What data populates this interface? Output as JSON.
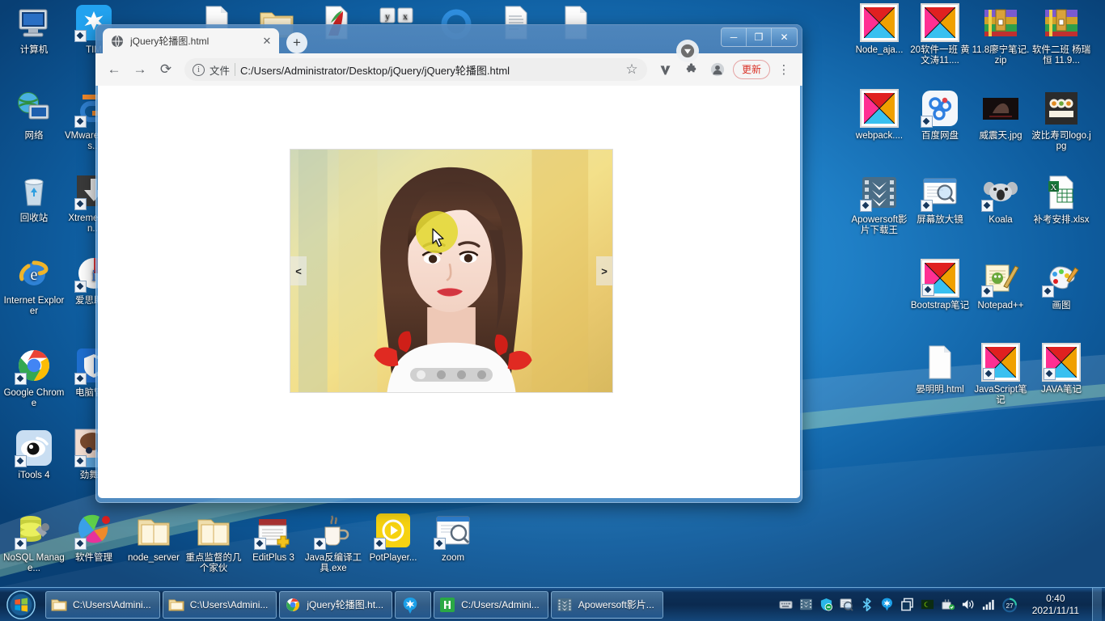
{
  "desktop": {
    "icons_col1": [
      {
        "label": "计算机",
        "icon": "computer-icon",
        "shortcut": false
      },
      {
        "label": "网络",
        "icon": "network-icon",
        "shortcut": false
      },
      {
        "label": "回收站",
        "icon": "recycle-bin-icon",
        "shortcut": false
      },
      {
        "label": "Internet Explorer",
        "icon": "internet-explorer-icon",
        "shortcut": false
      },
      {
        "label": "Google Chrome",
        "icon": "google-chrome-icon",
        "shortcut": true
      },
      {
        "label": "iTools 4",
        "icon": "itools-icon",
        "shortcut": true
      },
      {
        "label": "NoSQL Manage...",
        "icon": "nosql-manager-icon",
        "shortcut": true
      }
    ],
    "icons_col2": [
      {
        "label": "TIM",
        "icon": "tim-icon",
        "shortcut": true
      },
      {
        "label": "VMware Works...",
        "icon": "vmware-workstation-icon",
        "shortcut": true
      },
      {
        "label": "Xtreme Down...",
        "icon": "xtreme-download-icon",
        "shortcut": true
      },
      {
        "label": "爱思助手",
        "icon": "aisi-assistant-icon",
        "shortcut": true
      },
      {
        "label": "电脑管家",
        "icon": "pc-manager-icon",
        "shortcut": true
      },
      {
        "label": "劲舞团",
        "icon": "audition-game-icon",
        "shortcut": true
      },
      {
        "label": "软件管理",
        "icon": "software-manager-icon",
        "shortcut": true
      }
    ],
    "icons_bottom_row": [
      {
        "label": "node_server",
        "icon": "folder-icon",
        "shortcut": false
      },
      {
        "label": "重点监督的几个家伙",
        "icon": "folder-icon",
        "shortcut": false
      },
      {
        "label": "EditPlus 3",
        "icon": "editplus-icon",
        "shortcut": true
      },
      {
        "label": "Java反编译工具.exe",
        "icon": "java-decompiler-icon",
        "shortcut": true
      },
      {
        "label": "PotPlayer...",
        "icon": "potplayer-icon",
        "shortcut": true
      },
      {
        "label": "zoom",
        "icon": "zoom-icon",
        "shortcut": true
      }
    ],
    "icons_right": [
      {
        "label": "Node_aja...",
        "icon": "broken-image-icon",
        "shortcut": false
      },
      {
        "label": "20软件一班 黄文涛11....",
        "icon": "broken-image-icon",
        "shortcut": false
      },
      {
        "label": "11.8廖宁笔记.zip",
        "icon": "winrar-archive-icon",
        "shortcut": false
      },
      {
        "label": "软件二班 杨瑞恒 11.9...",
        "icon": "winrar-archive-icon",
        "shortcut": false
      },
      {
        "label": "webpack....",
        "icon": "broken-image-icon",
        "shortcut": false
      },
      {
        "label": "百度网盘",
        "icon": "baidu-netdisk-icon",
        "shortcut": true
      },
      {
        "label": "威震天.jpg",
        "icon": "jpg-thumbnail-icon",
        "shortcut": false
      },
      {
        "label": "波比寿司logo.jpg",
        "icon": "jpg-thumbnail-icon",
        "shortcut": false
      },
      {
        "label": "Apowersoft影片下载王",
        "icon": "apowersoft-icon",
        "shortcut": true
      },
      {
        "label": "屏幕放大镜",
        "icon": "screen-magnifier-icon",
        "shortcut": true
      },
      {
        "label": "Koala",
        "icon": "koala-icon",
        "shortcut": true
      },
      {
        "label": "补考安排.xlsx",
        "icon": "excel-file-icon",
        "shortcut": false
      },
      {
        "label": "Bootstrap笔记",
        "icon": "broken-image-icon",
        "shortcut": true
      },
      {
        "label": "Notepad++",
        "icon": "notepadpp-icon",
        "shortcut": true
      },
      {
        "label": "画图",
        "icon": "paint-icon",
        "shortcut": true
      },
      {
        "label": "晏明明.html",
        "icon": "blank-file-icon",
        "shortcut": false
      },
      {
        "label": "JavaScript笔记",
        "icon": "broken-image-icon",
        "shortcut": true
      },
      {
        "label": "JAVA笔记",
        "icon": "broken-image-icon",
        "shortcut": true
      }
    ]
  },
  "browser": {
    "tab": {
      "title": "jQuery轮播图.html",
      "close_label": "✕",
      "favicon": "globe-icon"
    },
    "new_tab_label": "+",
    "window_controls": {
      "minimize": "─",
      "maximize": "❐",
      "close": "✕"
    },
    "toolbar": {
      "back": "←",
      "forward": "→",
      "reload": "⟳",
      "info_label": "i",
      "file_scheme_label": "文件",
      "url": "C:/Users/Administrator/Desktop/jQuery/jQuery轮播图.html",
      "star": "☆",
      "vimium_label": "V",
      "extensions_label": "🧩",
      "profile_label": "👤",
      "update_label": "更新",
      "menu_label": "⋮"
    }
  },
  "page": {
    "carousel": {
      "prev_label": "<",
      "next_label": ">",
      "slide_count": 4,
      "active_index": 0,
      "dots": [
        "1",
        "2",
        "3",
        "4"
      ]
    }
  },
  "taskbar": {
    "start_label": "开始",
    "items": [
      {
        "label": "C:\\Users\\Admini...",
        "icon": "folder-icon"
      },
      {
        "label": "C:\\Users\\Admini...",
        "icon": "folder-icon"
      },
      {
        "label": "jQuery轮播图.ht...",
        "icon": "google-chrome-icon"
      },
      {
        "label": "",
        "icon": "tim-icon"
      },
      {
        "label": "C:/Users/Admini...",
        "icon": "hbuilder-icon"
      },
      {
        "label": "Apowersoft影片...",
        "icon": "apowersoft-icon"
      }
    ],
    "tray": [
      {
        "name": "keyboard-layout-icon"
      },
      {
        "name": "apowersoft-tray-icon"
      },
      {
        "name": "security-shield-icon"
      },
      {
        "name": "screen-magnifier-tray-icon"
      },
      {
        "name": "bluetooth-icon"
      },
      {
        "name": "tim-tray-icon"
      },
      {
        "name": "window-switch-icon"
      },
      {
        "name": "nvidia-icon"
      },
      {
        "name": "safely-remove-hardware-icon"
      },
      {
        "name": "volume-icon"
      },
      {
        "name": "network-signal-icon"
      },
      {
        "name": "temperature-icon"
      }
    ],
    "temperature": "27",
    "clock": {
      "time": "0:40",
      "date": "2021/11/11"
    }
  },
  "colors": {
    "accent": "#1d86c9",
    "update_red": "#d93025",
    "highlight_yellow": "#e2d832",
    "taskbar_dark": "#0a284c"
  }
}
